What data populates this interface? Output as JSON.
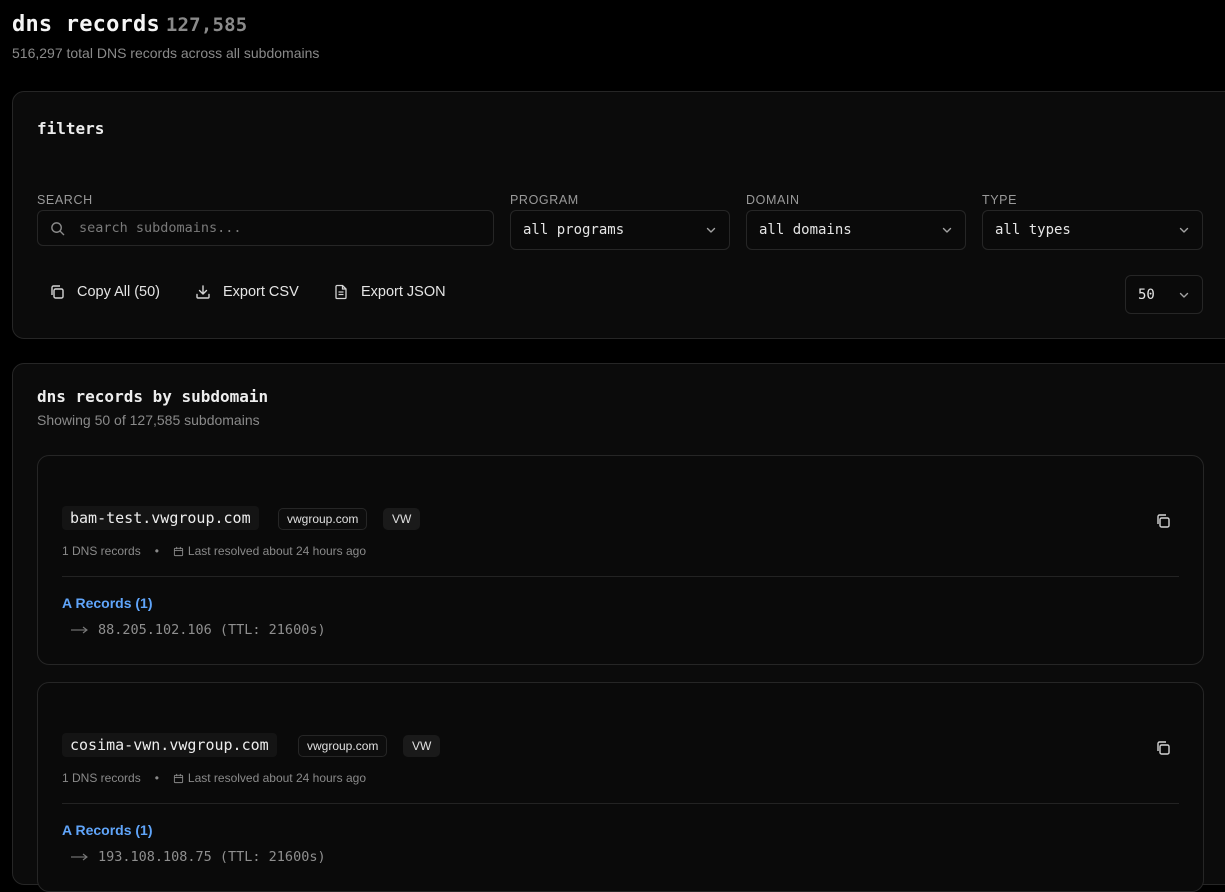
{
  "header": {
    "title": "dns records",
    "count": "127,585",
    "subtitle": "516,297 total DNS records across all subdomains"
  },
  "filters": {
    "title": "filters",
    "search": {
      "label": "SEARCH",
      "placeholder": "search subdomains...",
      "value": ""
    },
    "program": {
      "label": "PROGRAM",
      "value": "all programs"
    },
    "domain": {
      "label": "DOMAIN",
      "value": "all domains"
    },
    "type": {
      "label": "TYPE",
      "value": "all types"
    },
    "actions": {
      "copy_all": "Copy All (50)",
      "export_csv": "Export CSV",
      "export_json": "Export JSON"
    },
    "page_size": "50"
  },
  "records": {
    "title": "dns records by subdomain",
    "subtitle": "Showing 50 of 127,585 subdomains",
    "items": [
      {
        "name": "bam-test.vwgroup.com",
        "domain": "vwgroup.com",
        "program": "VW",
        "count": "1 DNS records",
        "resolved": "Last resolved about 24 hours ago",
        "record_group": "A Records (1)",
        "records": [
          "88.205.102.106 (TTL: 21600s)"
        ]
      },
      {
        "name": "cosima-vwn.vwgroup.com",
        "domain": "vwgroup.com",
        "program": "VW",
        "count": "1 DNS records",
        "resolved": "Last resolved about 24 hours ago",
        "record_group": "A Records (1)",
        "records": [
          "193.108.108.75 (TTL: 21600s)"
        ]
      }
    ]
  },
  "icons": {
    "search": "search-icon",
    "chevron": "chevron-down-icon",
    "copy": "copy-icon",
    "download": "download-icon",
    "file": "file-text-icon",
    "calendar": "calendar-icon",
    "arrow": "arrow-right-icon"
  },
  "colors": {
    "accent": "#60a5fa",
    "background": "#000000",
    "border": "#262626"
  }
}
